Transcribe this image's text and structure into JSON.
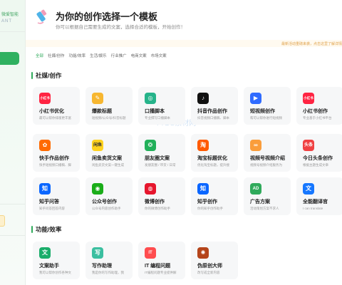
{
  "sidebar": {
    "brand_line1": "微爱智能",
    "brand_line2": "ANT"
  },
  "header": {
    "title": "为你的创作选择一个模板",
    "subtitle": "你可以根据自己需要生成的文案，选择合适的模板，开始创作！"
  },
  "notice": "最新活动重磅来袭，点击这里了解详情",
  "filters": [
    "全部",
    "社媒/创作",
    "功能/效率",
    "生活/娱乐",
    "行业推广",
    "电商文案",
    "市场文案"
  ],
  "watermark": "YYDS素材网",
  "sections": [
    {
      "title": "社媒/创作"
    },
    {
      "title": "功能/效率"
    }
  ],
  "cards": [
    {
      "name": "小红书优化",
      "desc": "最可以帮你排版更丰富",
      "icon": "xiaohongshu-icon",
      "glyph": "小红书",
      "color": "#ff2442"
    },
    {
      "name": "爆款标题",
      "desc": "短视频/公众号/抖音标题",
      "icon": "pencil-icon",
      "glyph": "✎",
      "color": "#f7b731"
    },
    {
      "name": "口播脚本",
      "desc": "专业撰写口播脚本",
      "icon": "film-reel-icon",
      "glyph": "◎",
      "color": "#26b38a"
    },
    {
      "name": "抖音作品创作",
      "desc": "抖音视频口播稿、脚本",
      "icon": "douyin-icon",
      "glyph": "♪",
      "color": "#111111"
    },
    {
      "name": "短视频创作",
      "desc": "帮可以帮你进行短视频",
      "icon": "play-icon",
      "glyph": "▶",
      "color": "#2f6bff"
    },
    {
      "name": "小红书创作",
      "desc": "专业基于小红书平台",
      "icon": "xiaohongshu-icon",
      "glyph": "小红书",
      "color": "#ff2442"
    },
    {
      "name": "快手作品创作",
      "desc": "快手短视频口播稿、脚",
      "icon": "kuaishou-icon",
      "glyph": "✿",
      "color": "#ff6a00"
    },
    {
      "name": "闲鱼卖货文案",
      "desc": "闲鱼卖货文案一键生成",
      "icon": "xianyu-icon",
      "glyph": "闲鱼",
      "color": "#ffd21e"
    },
    {
      "name": "朋友圈文案",
      "desc": "发朋友圈 / 带货 / 日常",
      "icon": "aperture-icon",
      "glyph": "❂",
      "color": "#22b05a"
    },
    {
      "name": "淘宝标题优化",
      "desc": "优化淘宝标题，提升搜",
      "icon": "taobao-icon",
      "glyph": "淘",
      "color": "#ff5a00"
    },
    {
      "name": "视频号视频介绍",
      "desc": "视频号视频介绍服务为",
      "icon": "channels-icon",
      "glyph": "∞",
      "color": "#fa9d3b"
    },
    {
      "name": "今日头条创作",
      "desc": "根据主题生成文章",
      "icon": "toutiao-icon",
      "glyph": "头条",
      "color": "#f04142"
    },
    {
      "name": "知乎问答",
      "desc": "知乎问答回答内容",
      "icon": "zhihu-icon",
      "glyph": "知",
      "color": "#0a66ff"
    },
    {
      "name": "公众号创作",
      "desc": "公众号内容创作助手",
      "icon": "wechat-icon",
      "glyph": "◉",
      "color": "#1aad19"
    },
    {
      "name": "微博创作",
      "desc": "你的微博创作助手",
      "icon": "weibo-icon",
      "glyph": "◍",
      "color": "#e6162d"
    },
    {
      "name": "知乎创作",
      "desc": "你的知乎创作助手",
      "icon": "zhihu-icon",
      "glyph": "知",
      "color": "#0a66ff"
    },
    {
      "name": "广告方案",
      "desc": "活动策划方案不求人",
      "icon": "ad-icon",
      "glyph": "AD",
      "color": "#2faa5b"
    },
    {
      "name": "全能翻译官",
      "desc": "I can translate",
      "icon": "translate-icon",
      "glyph": "文",
      "color": "#1677ff"
    },
    {
      "name": "文案助手",
      "desc": "我可以帮你创作各种文",
      "icon": "document-icon",
      "glyph": "文",
      "color": "#1aad6a"
    },
    {
      "name": "写作助理",
      "desc": "我是你的写作助理，我",
      "icon": "write-icon",
      "glyph": "写",
      "color": "#3bbfa0"
    },
    {
      "name": "IT 编程问题",
      "desc": "IT编程问题专业提供解",
      "icon": "code-icon",
      "glyph": "IT",
      "color": "#ff4d4f"
    },
    {
      "name": "伪原创大师",
      "desc": "改写成全新内容",
      "icon": "rewrite-icon",
      "glyph": "✺",
      "color": "#b5451b"
    }
  ]
}
